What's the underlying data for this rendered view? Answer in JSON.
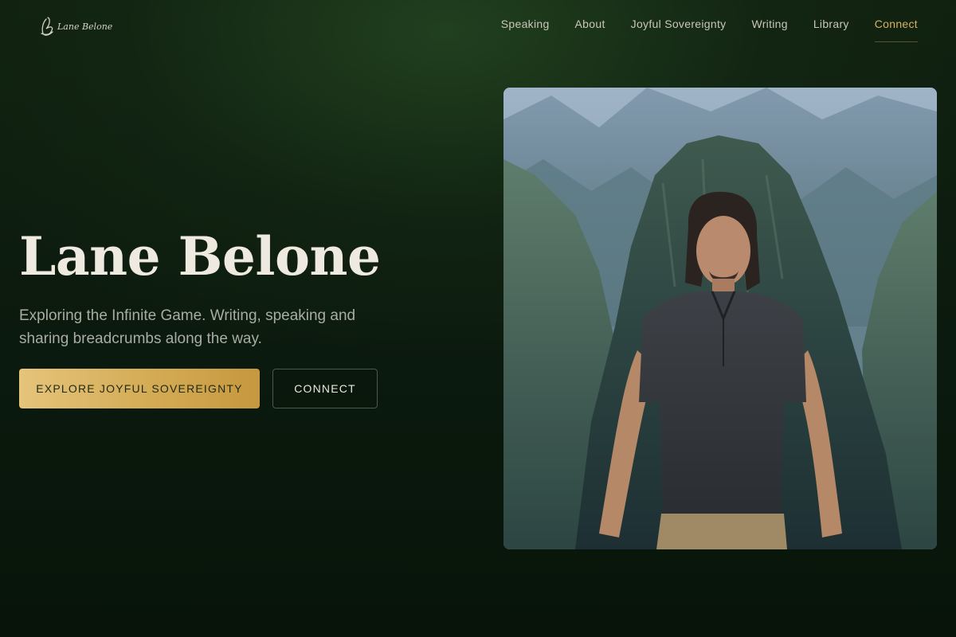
{
  "header": {
    "logo_text": "Lane Belone",
    "nav": [
      {
        "label": "Speaking",
        "active": false
      },
      {
        "label": "About",
        "active": false
      },
      {
        "label": "Joyful Sovereignty",
        "active": false
      },
      {
        "label": "Writing",
        "active": false
      },
      {
        "label": "Library",
        "active": false
      },
      {
        "label": "Connect",
        "active": true
      }
    ]
  },
  "hero": {
    "title": "Lane Belone",
    "subtitle": "Exploring the Infinite Game. Writing, speaking and sharing breadcrumbs along the way.",
    "primary_cta": "EXPLORE JOYFUL SOVEREIGNTY",
    "secondary_cta": "CONNECT"
  },
  "photo": {
    "subject": "man-standing-before-mountains"
  },
  "colors": {
    "accent_gold": "#d8b25e",
    "background_green": "#0b1a0e",
    "text_light": "#efeadf",
    "text_muted": "#a8ad9f"
  }
}
